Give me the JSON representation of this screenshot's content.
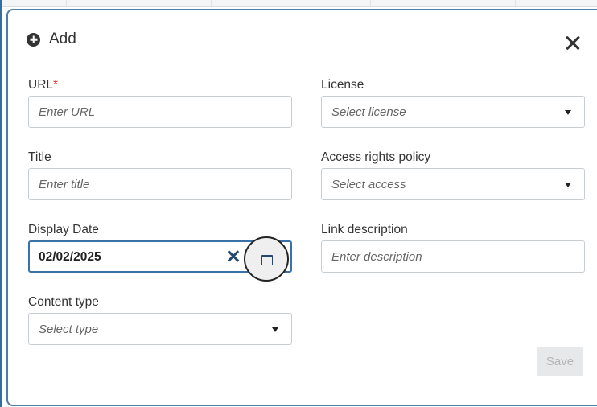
{
  "dialog": {
    "title": "Add",
    "icon": "add-circle-icon",
    "close_icon": "close-icon"
  },
  "fields": {
    "url": {
      "label": "URL",
      "required_mark": "*",
      "placeholder": "Enter URL"
    },
    "title": {
      "label": "Title",
      "placeholder": "Enter title"
    },
    "display_date": {
      "label": "Display Date",
      "value": "02/02/2025",
      "clear_icon": "clear-x-icon",
      "calendar_icon": "calendar-icon"
    },
    "content_type": {
      "label": "Content type",
      "placeholder": "Select type"
    },
    "license": {
      "label": "License",
      "placeholder": "Select license"
    },
    "access_rights_policy": {
      "label": "Access rights policy",
      "placeholder": "Select access"
    },
    "link_description": {
      "label": "Link description",
      "placeholder": "Enter description"
    }
  },
  "actions": {
    "save_label": "Save"
  },
  "colors": {
    "accent": "#3a72a8",
    "required": "#d9342b",
    "text": "#333333",
    "disabled_bg": "#e6e8ea",
    "disabled_text": "#b2b6ba"
  }
}
